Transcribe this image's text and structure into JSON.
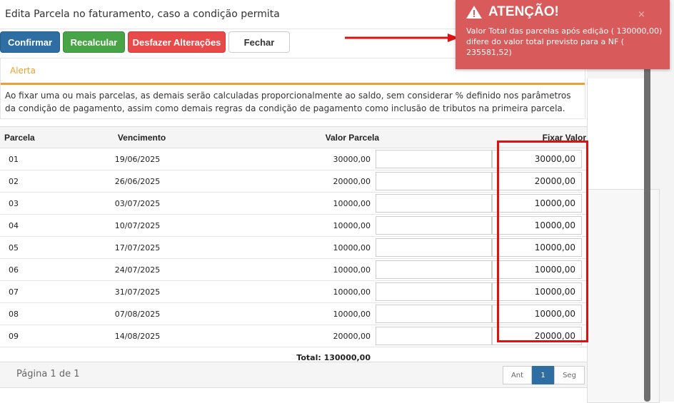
{
  "modal": {
    "title": "Edita Parcela no faturamento, caso a condição permita"
  },
  "toolbar": {
    "confirm_label": "Confirmar",
    "recalc_label": "Recalcular",
    "undo_label": "Desfazer Alterações",
    "close_label": "Fechar"
  },
  "alert": {
    "title": "Alerta",
    "body": "Ao fixar uma ou mais parcelas, as demais serão calculadas proporcionalmente ao saldo, sem considerar % definido nos parâmetros da condição de pagamento, assim como demais regras da condição de pagamento como inclusão de tributos na primeira parcela."
  },
  "table": {
    "headers": {
      "parcela": "Parcela",
      "vencimento": "Vencimento",
      "valor": "Valor Parcela",
      "fixar": "Fixar Valor"
    },
    "rows": [
      {
        "parcela": "01",
        "vencimento": "19/06/2025",
        "valor": "30000,00",
        "fixar": "30000,00"
      },
      {
        "parcela": "02",
        "vencimento": "26/06/2025",
        "valor": "20000,00",
        "fixar": "20000,00"
      },
      {
        "parcela": "03",
        "vencimento": "03/07/2025",
        "valor": "10000,00",
        "fixar": "10000,00"
      },
      {
        "parcela": "04",
        "vencimento": "10/07/2025",
        "valor": "10000,00",
        "fixar": "10000,00"
      },
      {
        "parcela": "05",
        "vencimento": "17/07/2025",
        "valor": "10000,00",
        "fixar": "10000,00"
      },
      {
        "parcela": "06",
        "vencimento": "24/07/2025",
        "valor": "10000,00",
        "fixar": "10000,00"
      },
      {
        "parcela": "07",
        "vencimento": "31/07/2025",
        "valor": "10000,00",
        "fixar": "10000,00"
      },
      {
        "parcela": "08",
        "vencimento": "07/08/2025",
        "valor": "10000,00",
        "fixar": "10000,00"
      },
      {
        "parcela": "09",
        "vencimento": "14/08/2025",
        "valor": "20000,00",
        "fixar": "20000,00"
      }
    ],
    "total": "Total: 130000,00"
  },
  "pagination": {
    "info": "Página 1 de 1",
    "prev": "Ant",
    "current": "1",
    "next": "Seg"
  },
  "toast": {
    "title": "ATENÇÃO!",
    "message": "Valor Total das parcelas após edição ( 130000,00) difere do valor total previsto para a NF ( 235581,52)",
    "close": "×"
  },
  "colors": {
    "primary": "#2f6ea3",
    "success": "#47a447",
    "danger": "#e84a4a",
    "warning": "#f0a030",
    "toast": "#d95a5a",
    "highlight": "#e01010"
  }
}
